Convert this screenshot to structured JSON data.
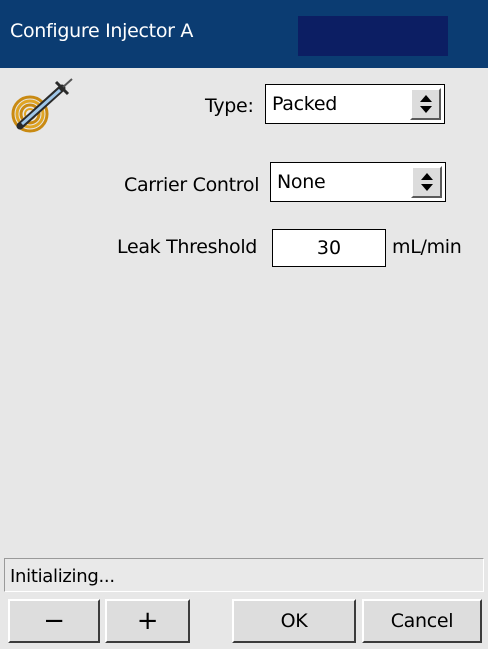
{
  "window": {
    "title": "Configure Injector A",
    "title_bar_color": "#0b3c72"
  },
  "icon": "injector-coil-icon",
  "form": {
    "type": {
      "label": "Type:",
      "value": "Packed"
    },
    "carrier_control": {
      "label": "Carrier Control",
      "value": "None"
    },
    "leak_threshold": {
      "label": "Leak Threshold",
      "value": "30",
      "unit": "mL/min"
    }
  },
  "status": {
    "text": "Initializing..."
  },
  "buttons": {
    "minus": "−",
    "plus": "+",
    "ok": "OK",
    "cancel": "Cancel"
  }
}
